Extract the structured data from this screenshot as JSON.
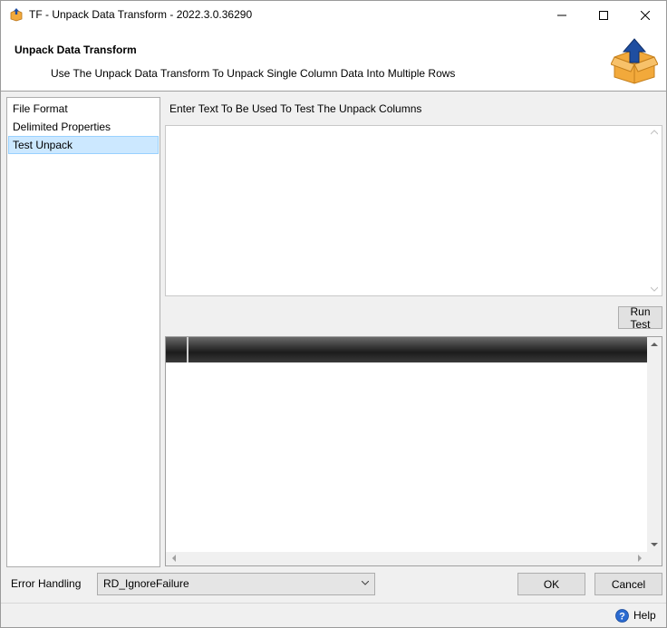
{
  "window": {
    "title": "TF - Unpack Data Transform - 2022.3.0.36290"
  },
  "header": {
    "title": "Unpack Data Transform",
    "subtitle": "Use The Unpack Data Transform To Unpack Single Column Data Into Multiple Rows",
    "logo_icon": "unpack-box-icon"
  },
  "nav": {
    "items": [
      {
        "label": "File Format",
        "selected": false
      },
      {
        "label": "Delimited Properties",
        "selected": false
      },
      {
        "label": "Test Unpack",
        "selected": true
      }
    ]
  },
  "main": {
    "test_label": "Enter Text To Be Used To Test The Unpack Columns",
    "test_text": "",
    "run_button": "Run Test"
  },
  "footer": {
    "error_label": "Error Handling",
    "error_value": "RD_IgnoreFailure",
    "ok_label": "OK",
    "cancel_label": "Cancel",
    "help_label": "Help"
  },
  "colors": {
    "selection_bg": "#cce8ff",
    "selection_border": "#99d1ff",
    "logo_orange": "#f2a93b",
    "logo_arrow": "#1f4ea1",
    "help_blue": "#2a6ad0"
  }
}
